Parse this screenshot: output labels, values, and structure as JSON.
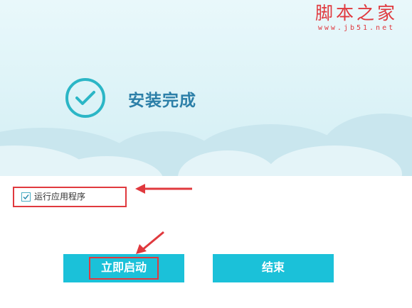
{
  "watermark": {
    "title": "脚本之家",
    "url": "www.jb51.net"
  },
  "status": {
    "title": "安装完成",
    "icon": "check-circle-icon"
  },
  "option": {
    "label": "运行应用程序",
    "checked": true,
    "icon": "checkbox-checked-icon"
  },
  "buttons": {
    "start_label": "立即启动",
    "end_label": "结束"
  },
  "colors": {
    "accent": "#1bc1d9",
    "check": "#2bb6c6",
    "title": "#2c7fa8",
    "annotation": "#e0393e"
  }
}
